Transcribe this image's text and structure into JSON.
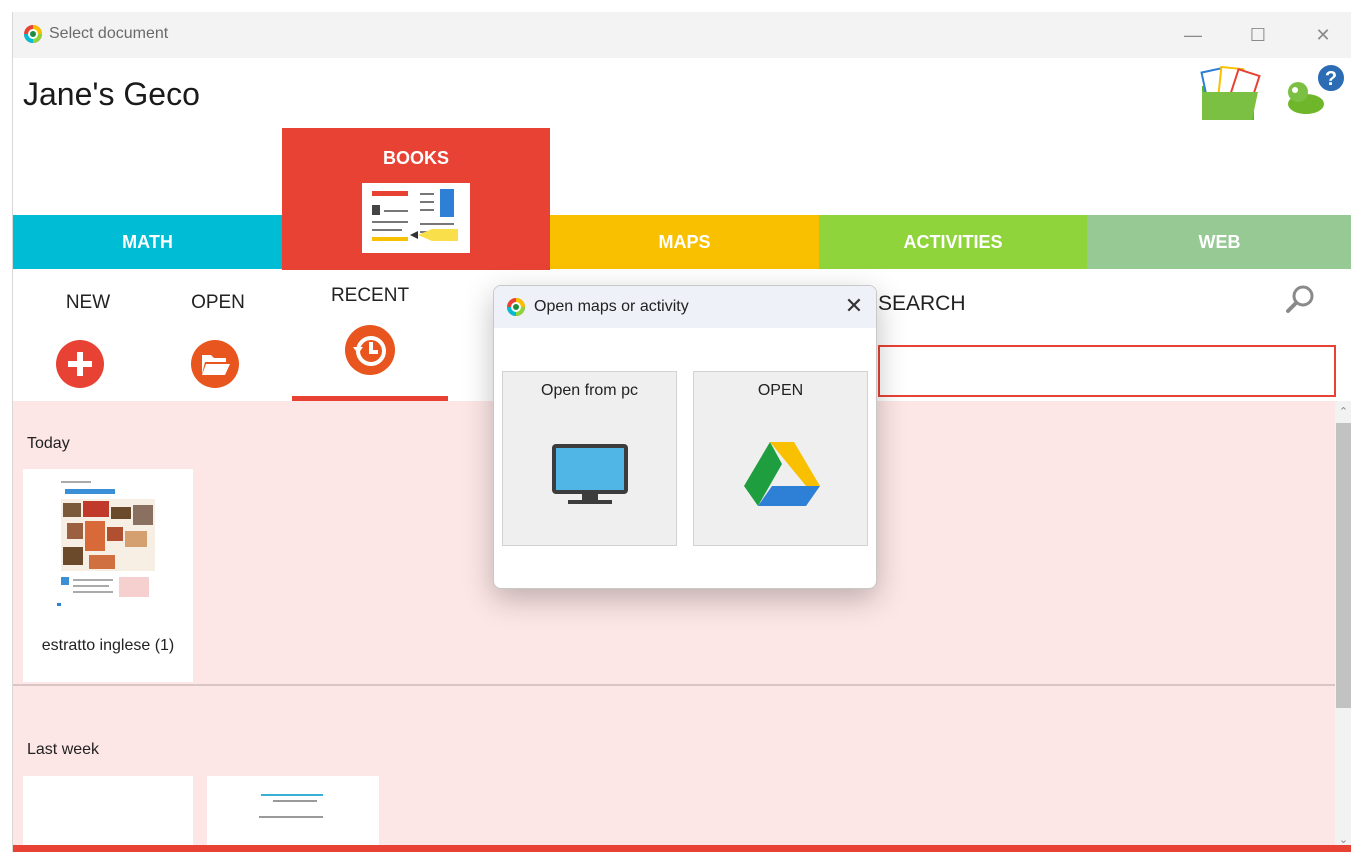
{
  "window": {
    "title": "Select document"
  },
  "header": {
    "user_name": "Jane's Geco"
  },
  "tabs": {
    "math": "MATH",
    "books": "BOOKS",
    "maps": "MAPS",
    "activities": "ACTIVITIES",
    "web": "WEB"
  },
  "toolbar": {
    "new_label": "NEW",
    "open_label": "OPEN",
    "recent_label": "RECENT",
    "search_label": "SEARCH",
    "search_value": ""
  },
  "recent": {
    "sections": [
      {
        "label": "Today",
        "items": [
          {
            "title": "estratto inglese (1)"
          }
        ]
      },
      {
        "label": "Last week",
        "items": [
          {
            "title": ""
          },
          {
            "title": ""
          }
        ]
      }
    ]
  },
  "dialog": {
    "title": "Open maps or activity",
    "options": [
      {
        "label": "Open from pc"
      },
      {
        "label": "OPEN"
      }
    ]
  },
  "colors": {
    "red": "#e84235",
    "math": "#00bcd4",
    "maps": "#f9c000",
    "activities": "#8fd43a",
    "web": "#97c995",
    "content_bg": "#fde6e6"
  }
}
